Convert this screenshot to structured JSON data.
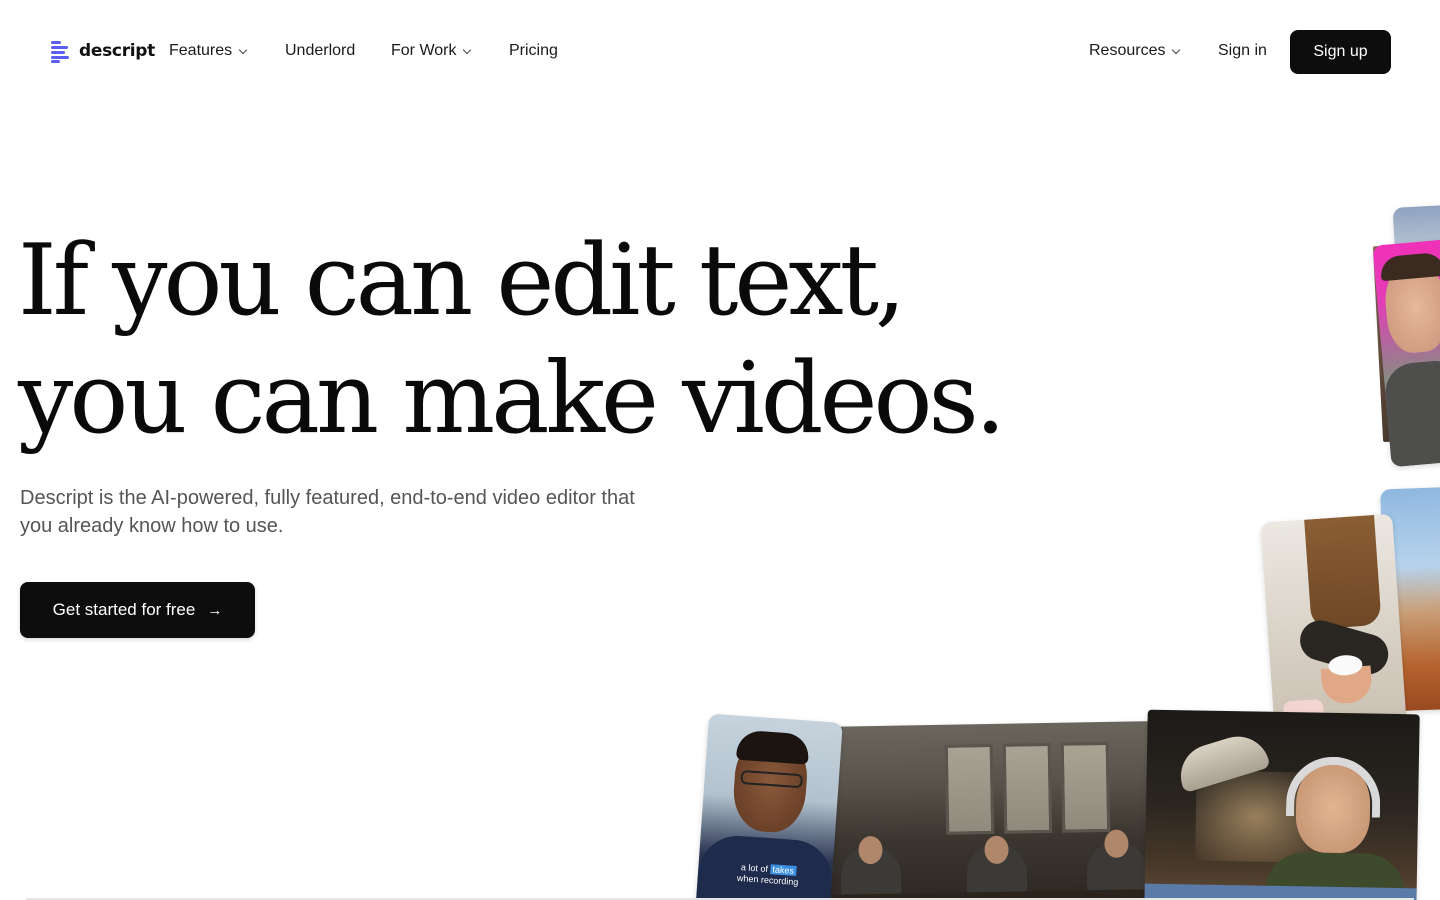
{
  "brand": {
    "name": "descript",
    "accent": "#5b5ef4"
  },
  "nav": {
    "features": "Features",
    "underlord": "Underlord",
    "for_work": "For Work",
    "pricing": "Pricing",
    "resources": "Resources",
    "sign_in": "Sign in",
    "sign_up": "Sign up"
  },
  "hero": {
    "headline_line1": "If you can edit text,",
    "headline_line2": "you can make videos.",
    "subtitle": "Descript is the AI-powered, fully featured, end-to-end video editor that you already know how to use.",
    "cta_label": "Get started for free",
    "cta_icon": "arrow-right-icon"
  },
  "media": {
    "caption_line1_a": "a lot of",
    "caption_line1_b": "takes",
    "caption_line2": "when recording"
  }
}
